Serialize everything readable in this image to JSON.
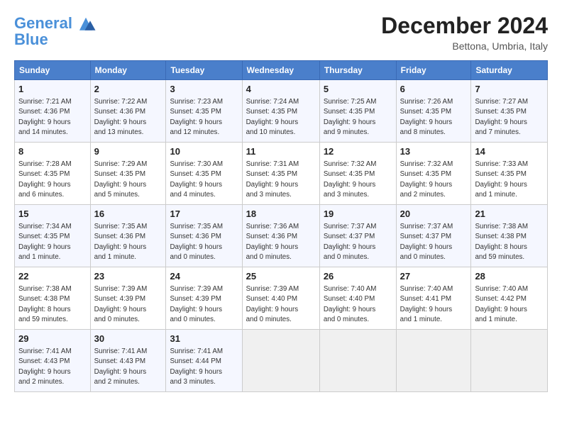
{
  "header": {
    "logo_line1": "General",
    "logo_line2": "Blue",
    "month": "December 2024",
    "location": "Bettona, Umbria, Italy"
  },
  "weekdays": [
    "Sunday",
    "Monday",
    "Tuesday",
    "Wednesday",
    "Thursday",
    "Friday",
    "Saturday"
  ],
  "weeks": [
    [
      {
        "day": "1",
        "info": "Sunrise: 7:21 AM\nSunset: 4:36 PM\nDaylight: 9 hours\nand 14 minutes."
      },
      {
        "day": "2",
        "info": "Sunrise: 7:22 AM\nSunset: 4:36 PM\nDaylight: 9 hours\nand 13 minutes."
      },
      {
        "day": "3",
        "info": "Sunrise: 7:23 AM\nSunset: 4:35 PM\nDaylight: 9 hours\nand 12 minutes."
      },
      {
        "day": "4",
        "info": "Sunrise: 7:24 AM\nSunset: 4:35 PM\nDaylight: 9 hours\nand 10 minutes."
      },
      {
        "day": "5",
        "info": "Sunrise: 7:25 AM\nSunset: 4:35 PM\nDaylight: 9 hours\nand 9 minutes."
      },
      {
        "day": "6",
        "info": "Sunrise: 7:26 AM\nSunset: 4:35 PM\nDaylight: 9 hours\nand 8 minutes."
      },
      {
        "day": "7",
        "info": "Sunrise: 7:27 AM\nSunset: 4:35 PM\nDaylight: 9 hours\nand 7 minutes."
      }
    ],
    [
      {
        "day": "8",
        "info": "Sunrise: 7:28 AM\nSunset: 4:35 PM\nDaylight: 9 hours\nand 6 minutes."
      },
      {
        "day": "9",
        "info": "Sunrise: 7:29 AM\nSunset: 4:35 PM\nDaylight: 9 hours\nand 5 minutes."
      },
      {
        "day": "10",
        "info": "Sunrise: 7:30 AM\nSunset: 4:35 PM\nDaylight: 9 hours\nand 4 minutes."
      },
      {
        "day": "11",
        "info": "Sunrise: 7:31 AM\nSunset: 4:35 PM\nDaylight: 9 hours\nand 3 minutes."
      },
      {
        "day": "12",
        "info": "Sunrise: 7:32 AM\nSunset: 4:35 PM\nDaylight: 9 hours\nand 3 minutes."
      },
      {
        "day": "13",
        "info": "Sunrise: 7:32 AM\nSunset: 4:35 PM\nDaylight: 9 hours\nand 2 minutes."
      },
      {
        "day": "14",
        "info": "Sunrise: 7:33 AM\nSunset: 4:35 PM\nDaylight: 9 hours\nand 1 minute."
      }
    ],
    [
      {
        "day": "15",
        "info": "Sunrise: 7:34 AM\nSunset: 4:35 PM\nDaylight: 9 hours\nand 1 minute."
      },
      {
        "day": "16",
        "info": "Sunrise: 7:35 AM\nSunset: 4:36 PM\nDaylight: 9 hours\nand 1 minute."
      },
      {
        "day": "17",
        "info": "Sunrise: 7:35 AM\nSunset: 4:36 PM\nDaylight: 9 hours\nand 0 minutes."
      },
      {
        "day": "18",
        "info": "Sunrise: 7:36 AM\nSunset: 4:36 PM\nDaylight: 9 hours\nand 0 minutes."
      },
      {
        "day": "19",
        "info": "Sunrise: 7:37 AM\nSunset: 4:37 PM\nDaylight: 9 hours\nand 0 minutes."
      },
      {
        "day": "20",
        "info": "Sunrise: 7:37 AM\nSunset: 4:37 PM\nDaylight: 9 hours\nand 0 minutes."
      },
      {
        "day": "21",
        "info": "Sunrise: 7:38 AM\nSunset: 4:38 PM\nDaylight: 8 hours\nand 59 minutes."
      }
    ],
    [
      {
        "day": "22",
        "info": "Sunrise: 7:38 AM\nSunset: 4:38 PM\nDaylight: 8 hours\nand 59 minutes."
      },
      {
        "day": "23",
        "info": "Sunrise: 7:39 AM\nSunset: 4:39 PM\nDaylight: 9 hours\nand 0 minutes."
      },
      {
        "day": "24",
        "info": "Sunrise: 7:39 AM\nSunset: 4:39 PM\nDaylight: 9 hours\nand 0 minutes."
      },
      {
        "day": "25",
        "info": "Sunrise: 7:39 AM\nSunset: 4:40 PM\nDaylight: 9 hours\nand 0 minutes."
      },
      {
        "day": "26",
        "info": "Sunrise: 7:40 AM\nSunset: 4:40 PM\nDaylight: 9 hours\nand 0 minutes."
      },
      {
        "day": "27",
        "info": "Sunrise: 7:40 AM\nSunset: 4:41 PM\nDaylight: 9 hours\nand 1 minute."
      },
      {
        "day": "28",
        "info": "Sunrise: 7:40 AM\nSunset: 4:42 PM\nDaylight: 9 hours\nand 1 minute."
      }
    ],
    [
      {
        "day": "29",
        "info": "Sunrise: 7:41 AM\nSunset: 4:43 PM\nDaylight: 9 hours\nand 2 minutes."
      },
      {
        "day": "30",
        "info": "Sunrise: 7:41 AM\nSunset: 4:43 PM\nDaylight: 9 hours\nand 2 minutes."
      },
      {
        "day": "31",
        "info": "Sunrise: 7:41 AM\nSunset: 4:44 PM\nDaylight: 9 hours\nand 3 minutes."
      },
      null,
      null,
      null,
      null
    ]
  ]
}
